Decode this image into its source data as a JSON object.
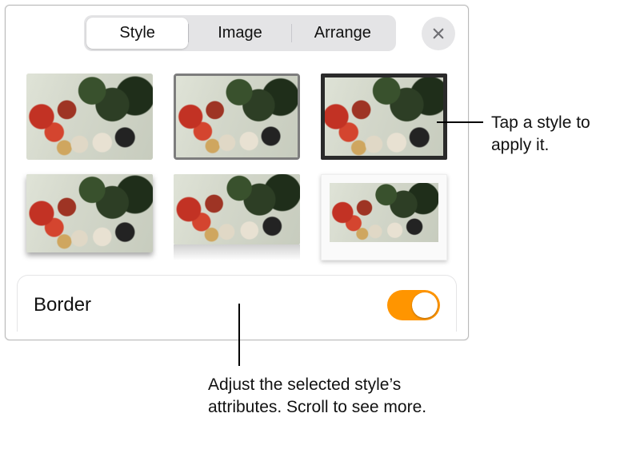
{
  "tabs": {
    "style": "Style",
    "image": "Image",
    "arrange": "Arrange",
    "active": "style"
  },
  "close_icon": "close-icon",
  "styles_grid": {
    "items": [
      {
        "name": "style-thumb-plain",
        "variant": "style-plain"
      },
      {
        "name": "style-thumb-selected",
        "variant": "style-select"
      },
      {
        "name": "style-thumb-darkframe",
        "variant": "style-darkframe"
      },
      {
        "name": "style-thumb-shadow",
        "variant": "style-shadow"
      },
      {
        "name": "style-thumb-reflect",
        "variant": "style-reflect"
      },
      {
        "name": "style-thumb-polaroid",
        "variant": "style-polaroid"
      }
    ]
  },
  "border": {
    "label": "Border",
    "on": true
  },
  "callouts": {
    "right": "Tap a style to apply it.",
    "bottom": "Adjust the selected style’s attributes. Scroll to see more."
  },
  "colors": {
    "accent": "#ff9500"
  }
}
